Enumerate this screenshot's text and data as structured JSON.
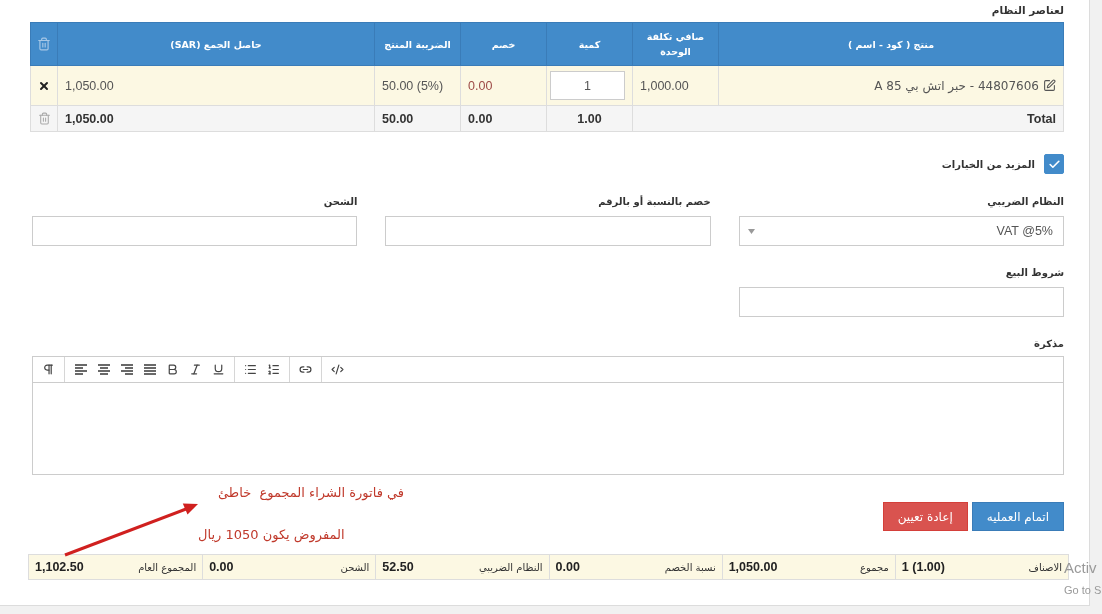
{
  "section_title": "لعناصر النظام",
  "items_table": {
    "columns": [
      "منتج ( كود - اسم )",
      "صافي تكلفة الوحدة",
      "كمية",
      "خصم",
      "الضريبة المنتج",
      "حاصل الجمع (SAR)"
    ],
    "rows": [
      {
        "product": "44807606 - حبر اتش بي 85 A",
        "unit_cost": "1,000.00",
        "quantity": "1",
        "discount": "0.00",
        "product_tax": "50.00 (5%)",
        "subtotal": "1,050.00"
      }
    ],
    "total_row": {
      "label": "Total",
      "quantity": "1.00",
      "discount": "0.00",
      "product_tax": "50.00",
      "subtotal": "1,050.00"
    }
  },
  "more_options": {
    "label": "المزيد من الخيارات",
    "checked": true
  },
  "fields": [
    {
      "kind": "select",
      "label": "النظام الضريبي",
      "value": "VAT @5%"
    },
    {
      "kind": "text",
      "label": "خصم بالنسبة أو بالرقم"
    },
    {
      "kind": "text",
      "label": "الشحن"
    },
    {
      "kind": "text",
      "label": "شروط البيع"
    }
  ],
  "note": {
    "label": "مذكرة"
  },
  "annotation": {
    "texts": [
      "في فاتورة الشراء المجموع  خاطئ",
      "المفروض يكون 1050 ريال"
    ]
  },
  "buttons": [
    {
      "kind": "primary",
      "label": "اتمام العمليه"
    },
    {
      "kind": "danger",
      "label": "إعادة تعيين"
    }
  ],
  "summary": [
    {
      "label": "الاصناف",
      "value": "1 (1.00)"
    },
    {
      "label": "مجموع",
      "value": "1,050.00"
    },
    {
      "label": "نسبة الخصم",
      "value": "0.00"
    },
    {
      "label": "النظام الضريبي",
      "value": "52.50"
    },
    {
      "label": "الشحن",
      "value": "0.00"
    },
    {
      "label": "المجموع العام",
      "value": "1,102.50"
    }
  ],
  "os_overlay": [
    "Activ",
    "Go to S"
  ]
}
